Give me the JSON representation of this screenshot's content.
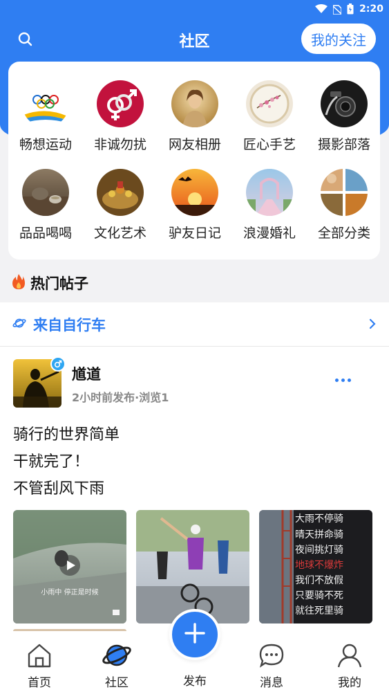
{
  "status_bar": {
    "time": "2:20"
  },
  "header": {
    "title": "社区",
    "follow_label": "我的关注",
    "colors": {
      "brand": "#2f7ef2"
    }
  },
  "categories": [
    {
      "label": "畅想运动",
      "icon": "olympic-rings-image"
    },
    {
      "label": "非诚勿扰",
      "icon": "gender-symbol-image"
    },
    {
      "label": "网友相册",
      "icon": "portrait-image"
    },
    {
      "label": "匠心手艺",
      "icon": "embroidery-image"
    },
    {
      "label": "摄影部落",
      "icon": "camera-image"
    },
    {
      "label": "品品喝喝",
      "icon": "tea-set-image"
    },
    {
      "label": "文化艺术",
      "icon": "art-craft-image"
    },
    {
      "label": "驴友日记",
      "icon": "sunset-bird-image"
    },
    {
      "label": "浪漫婚礼",
      "icon": "wedding-image"
    },
    {
      "label": "全部分类",
      "icon": "collage-image"
    }
  ],
  "hot": {
    "title": "热门帖子"
  },
  "post": {
    "source": "来自自行车",
    "author": "馗道",
    "meta": "2小时前发布·浏览1",
    "lines": [
      "骑行的世界简单",
      "干就完了！",
      "不管刮风下雨"
    ],
    "image_texts": {
      "video_caption": "小雨中 停正是时候",
      "banner_lines": [
        "大雨不停骑",
        "晴天拼命骑",
        "夜间挑灯骑",
        "地球不爆炸",
        "我们不放假",
        "只要骑不死",
        "就往死里骑"
      ]
    }
  },
  "bottom_nav": {
    "home": "首页",
    "community": "社区",
    "publish": "发布",
    "messages": "消息",
    "mine": "我的"
  }
}
